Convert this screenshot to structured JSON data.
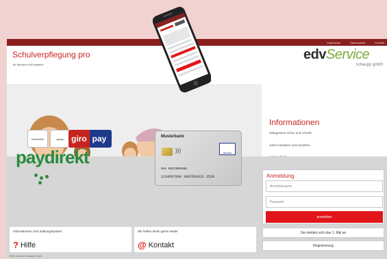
{
  "topnav": [
    "Impressum",
    "Datenschutz",
    "Kontakt"
  ],
  "brand": {
    "title": "Schulverpflegung pro",
    "subtitle": "für Mensen und Kantinen"
  },
  "logo": {
    "main_a": "edv",
    "main_b": "Service",
    "sub": "schaupp gmbh"
  },
  "info": {
    "title": "Informationen",
    "lines": [
      "Mittagessen sicher und schnell",
      "online bestellen und bezahlen",
      "mit paydirekt"
    ]
  },
  "payment": {
    "chip1": "kontaktlos",
    "chip2": "girogo",
    "giro": "giro",
    "pay": "pay",
    "paydirekt": "paydirekt"
  },
  "card": {
    "bank": "Musterbank",
    "brand": "girocard",
    "holder": "MAX MUSTERMANN",
    "number": "1234567890  3987654321    2520"
  },
  "login": {
    "title": "Anmeldung",
    "user_placeholder": "Anmeldename",
    "pass_placeholder": "Passwort",
    "button": "anmelden",
    "first_login": "Sie melden sich das 1. Mal an",
    "register": "Registrierung"
  },
  "help": {
    "caption": "Informationen zum Zahlungssystem:",
    "icon": "?",
    "label": "Hilfe"
  },
  "contact": {
    "caption": "Wir helfen Ihnen gerne weiter",
    "icon": "@",
    "label": "Kontakt"
  },
  "footer": {
    "copyright": "©EDV-Service Schaupp GmbH"
  },
  "colors": {
    "accent": "#e2161a",
    "title_red": "#c8241f",
    "green": "#7aae3b",
    "topbar": "#8a1f1f",
    "bg": "#f2d2d0"
  }
}
